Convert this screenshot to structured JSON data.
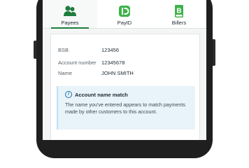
{
  "tabs": [
    {
      "label": "Payees",
      "icon": "payees-icon",
      "active": true
    },
    {
      "label": "PayID",
      "icon": "payid-icon",
      "active": false
    },
    {
      "label": "Billers",
      "icon": "bpay-icon",
      "active": false
    }
  ],
  "details": {
    "bsb_label": "BSB",
    "bsb_value": "123456",
    "account_label": "Account number",
    "account_value": "12345678",
    "name_label": "Name",
    "name_value": "JOHN SMITH"
  },
  "notice": {
    "icon_glyph": "i",
    "title": "Account name match",
    "body": "The name you've entered appears to match payments made by other customers to this account."
  },
  "colors": {
    "brand_green": "#1e7d3c",
    "info_blue": "#1f6fa8",
    "notice_bg": "#e8f3fa"
  }
}
